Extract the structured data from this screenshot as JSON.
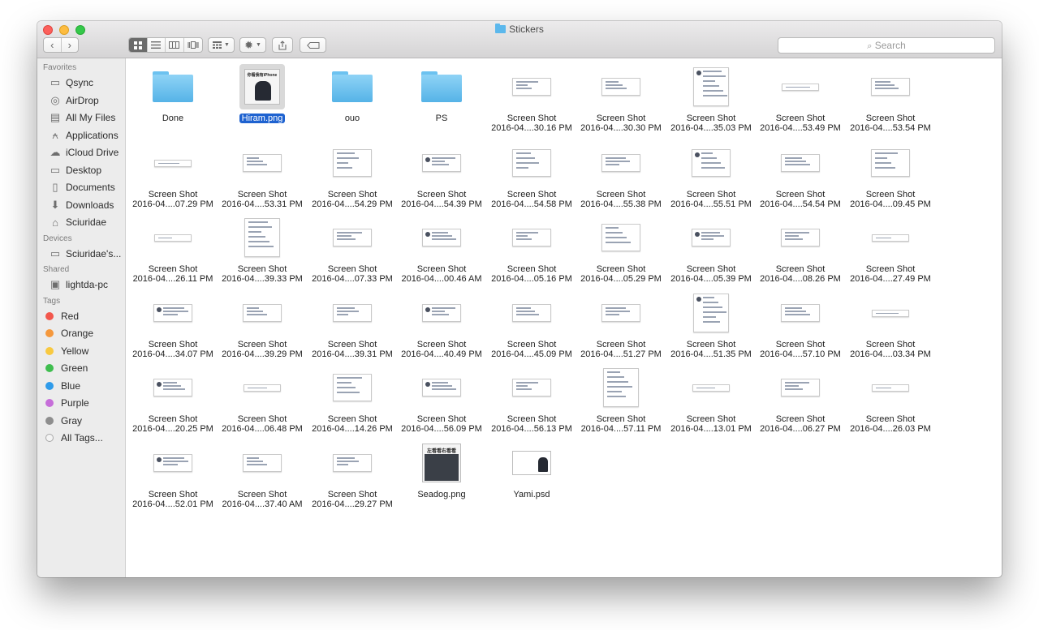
{
  "window": {
    "title": "Stickers",
    "search_placeholder": "Search"
  },
  "colors": {
    "selection": "#1e62d0",
    "folder": "#5cb8ec",
    "close": "#fc605c",
    "minimize": "#fdbc40",
    "zoom": "#34c84a"
  },
  "toolbar": {
    "back_icon": "chevron-left-icon",
    "forward_icon": "chevron-right-icon",
    "view_modes": [
      "icon-view",
      "list-view",
      "column-view",
      "cover-flow-view"
    ],
    "active_view": "icon-view",
    "arrange_icon": "arrange-grid-icon",
    "action_icon": "gear-icon",
    "share_icon": "share-icon",
    "tag_icon": "tag-icon"
  },
  "sidebar": {
    "favorites_title": "Favorites",
    "favorites": [
      {
        "label": "Qsync",
        "icon": "folder-icon"
      },
      {
        "label": "AirDrop",
        "icon": "airdrop-icon"
      },
      {
        "label": "All My Files",
        "icon": "all-files-icon"
      },
      {
        "label": "Applications",
        "icon": "applications-icon"
      },
      {
        "label": "iCloud Drive",
        "icon": "cloud-icon"
      },
      {
        "label": "Desktop",
        "icon": "desktop-icon"
      },
      {
        "label": "Documents",
        "icon": "documents-icon"
      },
      {
        "label": "Downloads",
        "icon": "downloads-icon"
      },
      {
        "label": "Sciuridae",
        "icon": "home-icon"
      }
    ],
    "devices_title": "Devices",
    "devices": [
      {
        "label": "Sciuridae's...",
        "icon": "laptop-icon"
      }
    ],
    "shared_title": "Shared",
    "shared": [
      {
        "label": "lightda-pc",
        "icon": "pc-icon"
      }
    ],
    "tags_title": "Tags",
    "tags": [
      {
        "label": "Red",
        "color": "#f2574c"
      },
      {
        "label": "Orange",
        "color": "#f5983c"
      },
      {
        "label": "Yellow",
        "color": "#f8c940"
      },
      {
        "label": "Green",
        "color": "#3fbe4f"
      },
      {
        "label": "Blue",
        "color": "#2f9bea"
      },
      {
        "label": "Purple",
        "color": "#c66ed9"
      },
      {
        "label": "Gray",
        "color": "#8e8e8e"
      },
      {
        "label": "All Tags...",
        "color": ""
      }
    ]
  },
  "files": [
    {
      "kind": "folder",
      "line1": "Done",
      "line2": ""
    },
    {
      "kind": "selected",
      "line1": "Hiram.png",
      "line2": "",
      "caption": "你看我有iPhone"
    },
    {
      "kind": "folder",
      "line1": "ouo",
      "line2": ""
    },
    {
      "kind": "folder",
      "line1": "PS",
      "line2": ""
    },
    {
      "kind": "shot",
      "line1": "Screen Shot",
      "line2": "2016-04....30.16 PM",
      "shape": "wide"
    },
    {
      "kind": "shot",
      "line1": "Screen Shot",
      "line2": "2016-04....30.30 PM",
      "shape": "wide"
    },
    {
      "kind": "shot",
      "line1": "Screen Shot",
      "line2": "2016-04....35.03 PM",
      "shape": "tall"
    },
    {
      "kind": "shot",
      "line1": "Screen Shot",
      "line2": "2016-04....53.49 PM",
      "shape": "strip"
    },
    {
      "kind": "shot",
      "line1": "Screen Shot",
      "line2": "2016-04....53.54 PM",
      "shape": "wide"
    },
    {
      "kind": "shot",
      "line1": "Screen Shot",
      "line2": "2016-04....07.29 PM",
      "shape": "strip"
    },
    {
      "kind": "shot",
      "line1": "Screen Shot",
      "line2": "2016-04....53.31 PM",
      "shape": "wide"
    },
    {
      "kind": "shot",
      "line1": "Screen Shot",
      "line2": "2016-04....54.29 PM",
      "shape": "mid"
    },
    {
      "kind": "shot",
      "line1": "Screen Shot",
      "line2": "2016-04....54.39 PM",
      "shape": "wide"
    },
    {
      "kind": "shot",
      "line1": "Screen Shot",
      "line2": "2016-04....54.58 PM",
      "shape": "mid"
    },
    {
      "kind": "shot",
      "line1": "Screen Shot",
      "line2": "2016-04....55.38 PM",
      "shape": "wide"
    },
    {
      "kind": "shot",
      "line1": "Screen Shot",
      "line2": "2016-04....55.51 PM",
      "shape": "mid"
    },
    {
      "kind": "shot",
      "line1": "Screen Shot",
      "line2": "2016-04....54.54 PM",
      "shape": "wide"
    },
    {
      "kind": "shot",
      "line1": "Screen Shot",
      "line2": "2016-04....09.45 PM",
      "shape": "mid"
    },
    {
      "kind": "shot",
      "line1": "Screen Shot",
      "line2": "2016-04....26.11 PM",
      "shape": "strip"
    },
    {
      "kind": "shot",
      "line1": "Screen Shot",
      "line2": "2016-04....39.33 PM",
      "shape": "tall"
    },
    {
      "kind": "shot",
      "line1": "Screen Shot",
      "line2": "2016-04....07.33 PM",
      "shape": "wide"
    },
    {
      "kind": "shot",
      "line1": "Screen Shot",
      "line2": "2016-04....00.46 AM",
      "shape": "wide"
    },
    {
      "kind": "shot",
      "line1": "Screen Shot",
      "line2": "2016-04....05.16 PM",
      "shape": "wide"
    },
    {
      "kind": "shot",
      "line1": "Screen Shot",
      "line2": "2016-04....05.29 PM",
      "shape": "mid"
    },
    {
      "kind": "shot",
      "line1": "Screen Shot",
      "line2": "2016-04....05.39 PM",
      "shape": "wide"
    },
    {
      "kind": "shot",
      "line1": "Screen Shot",
      "line2": "2016-04....08.26 PM",
      "shape": "wide"
    },
    {
      "kind": "shot",
      "line1": "Screen Shot",
      "line2": "2016-04....27.49 PM",
      "shape": "strip"
    },
    {
      "kind": "shot",
      "line1": "Screen Shot",
      "line2": "2016-04....34.07 PM",
      "shape": "wide"
    },
    {
      "kind": "shot",
      "line1": "Screen Shot",
      "line2": "2016-04....39.29 PM",
      "shape": "wide"
    },
    {
      "kind": "shot",
      "line1": "Screen Shot",
      "line2": "2016-04....39.31 PM",
      "shape": "wide"
    },
    {
      "kind": "shot",
      "line1": "Screen Shot",
      "line2": "2016-04....40.49 PM",
      "shape": "wide"
    },
    {
      "kind": "shot",
      "line1": "Screen Shot",
      "line2": "2016-04....45.09 PM",
      "shape": "wide"
    },
    {
      "kind": "shot",
      "line1": "Screen Shot",
      "line2": "2016-04....51.27 PM",
      "shape": "wide"
    },
    {
      "kind": "shot",
      "line1": "Screen Shot",
      "line2": "2016-04....51.35 PM",
      "shape": "tall"
    },
    {
      "kind": "shot",
      "line1": "Screen Shot",
      "line2": "2016-04....57.10 PM",
      "shape": "wide"
    },
    {
      "kind": "shot",
      "line1": "Screen Shot",
      "line2": "2016-04....03.34 PM",
      "shape": "strip"
    },
    {
      "kind": "shot",
      "line1": "Screen Shot",
      "line2": "2016-04....20.25 PM",
      "shape": "wide"
    },
    {
      "kind": "shot",
      "line1": "Screen Shot",
      "line2": "2016-04....06.48 PM",
      "shape": "strip"
    },
    {
      "kind": "shot",
      "line1": "Screen Shot",
      "line2": "2016-04....14.26 PM",
      "shape": "mid"
    },
    {
      "kind": "shot",
      "line1": "Screen Shot",
      "line2": "2016-04....56.09 PM",
      "shape": "wide"
    },
    {
      "kind": "shot",
      "line1": "Screen Shot",
      "line2": "2016-04....56.13 PM",
      "shape": "wide"
    },
    {
      "kind": "shot",
      "line1": "Screen Shot",
      "line2": "2016-04....57.11 PM",
      "shape": "tall"
    },
    {
      "kind": "shot",
      "line1": "Screen Shot",
      "line2": "2016-04....13.01 PM",
      "shape": "strip"
    },
    {
      "kind": "shot",
      "line1": "Screen Shot",
      "line2": "2016-04....06.27 PM",
      "shape": "wide"
    },
    {
      "kind": "shot",
      "line1": "Screen Shot",
      "line2": "2016-04....26.03 PM",
      "shape": "strip"
    },
    {
      "kind": "shot",
      "line1": "Screen Shot",
      "line2": "2016-04....52.01 PM",
      "shape": "wide"
    },
    {
      "kind": "shot",
      "line1": "Screen Shot",
      "line2": "2016-04....37.40 AM",
      "shape": "wide"
    },
    {
      "kind": "shot",
      "line1": "Screen Shot",
      "line2": "2016-04....29.27 PM",
      "shape": "wide"
    },
    {
      "kind": "photo",
      "line1": "Seadog.png",
      "line2": "",
      "caption": "左看看右看看"
    },
    {
      "kind": "psd",
      "line1": "Yami.psd",
      "line2": ""
    }
  ]
}
